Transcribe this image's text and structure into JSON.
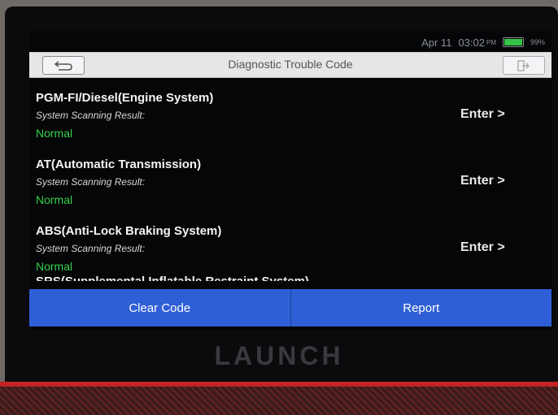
{
  "status_bar": {
    "date": "Apr 11",
    "time": "03:02",
    "ampm": "PM",
    "battery_level": 0.99,
    "battery_text": "99%"
  },
  "header": {
    "title": "Diagnostic Trouble Code",
    "back_icon": "back-arrow-icon",
    "exit_icon": "exit-icon"
  },
  "systems": [
    {
      "name": "PGM-FI/Diesel(Engine System)",
      "scan_label": "System Scanning Result:",
      "result": "Normal",
      "action": "Enter >"
    },
    {
      "name": "AT(Automatic Transmission)",
      "scan_label": "System Scanning Result:",
      "result": "Normal",
      "action": "Enter >"
    },
    {
      "name": "ABS(Anti-Lock Braking System)",
      "scan_label": "System Scanning Result:",
      "result": "Normal",
      "action": "Enter >"
    }
  ],
  "partial_row": {
    "name": "SRS(Supplemental Inflatable Restraint System)"
  },
  "footer": {
    "clear_code": "Clear Code",
    "report": "Report"
  },
  "device_brand": "LAUNCH",
  "colors": {
    "accent_blue": "#2f5fd6",
    "normal_green": "#36d24a",
    "title_bar": "#e6e6e8"
  }
}
